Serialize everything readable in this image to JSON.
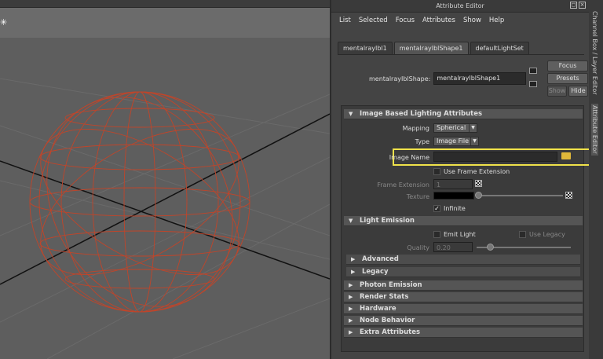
{
  "attribute_editor": {
    "title": "Attribute Editor",
    "menu": [
      "List",
      "Selected",
      "Focus",
      "Attributes",
      "Show",
      "Help"
    ],
    "tabs": [
      "mentalrayIbl1",
      "mentalrayIblShape1",
      "defaultLightSet"
    ],
    "shape_label": "mentalrayIblShape:",
    "shape_value": "mentalrayIblShape1",
    "buttons": {
      "focus": "Focus",
      "presets": "Presets",
      "show": "Show",
      "hide": "Hide"
    }
  },
  "ibl_section": {
    "title": "Image Based Lighting Attributes",
    "mapping_label": "Mapping",
    "mapping_value": "Spherical",
    "type_label": "Type",
    "type_value": "Image File",
    "image_name_label": "Image Name",
    "image_name_value": "",
    "use_frame_ext": "Use Frame Extension",
    "frame_ext_label": "Frame Extension",
    "frame_ext_value": "1",
    "texture_label": "Texture",
    "infinite": "Infinite"
  },
  "light_emission": {
    "title": "Light Emission",
    "emit_light": "Emit Light",
    "use_legacy": "Use Legacy",
    "quality_label": "Quality",
    "quality_value": "0.20"
  },
  "subsections": [
    "Advanced",
    "Legacy"
  ],
  "sections": [
    "Photon Emission",
    "Render Stats",
    "Hardware",
    "Node Behavior",
    "Extra Attributes"
  ],
  "side_tabs": {
    "channel_box": "Channel Box / Layer Editor",
    "attribute_editor": "Attribute Editor"
  },
  "colors": {
    "highlight": "#f0e24a",
    "wire": "#c0452a"
  }
}
